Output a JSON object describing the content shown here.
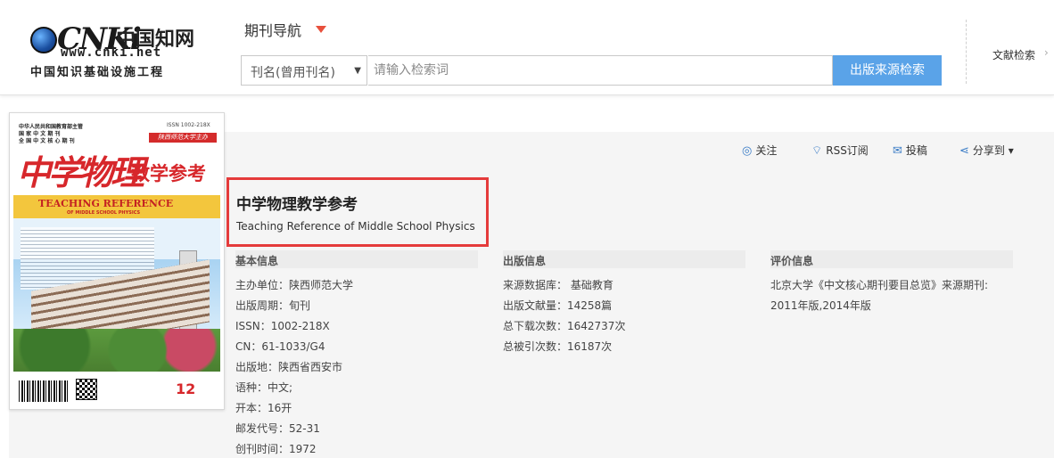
{
  "header": {
    "logo_cnki": "CNKi",
    "logo_cn": "中国知网",
    "logo_url": "www.cnki.net",
    "logo_sub": "中国知识基础设施工程",
    "nav_title": "期刊导航",
    "search_select_value": "刊名(曾用刊名)",
    "search_placeholder": "请输入检索词",
    "search_button": "出版来源检索",
    "right_link": "文献检索",
    "right_arrow": "›"
  },
  "cover": {
    "top_lines": "中华人民共和国教育部主管\n国 家 中 文 期 刊\n全 国 中 文 核 心 期 刊",
    "issn": "ISSN 1002-218X",
    "red_band": "陕西师范大学主办",
    "title_part1": "中学物理",
    "title_part2": "教学参考",
    "en_line1": "TEACHING REFERENCE",
    "en_line2": "OF MIDDLE SCHOOL PHYSICS",
    "year_issue": "12"
  },
  "actions": {
    "follow": "关注",
    "rss": "RSS订阅",
    "submit": "投稿",
    "share": "分享到 ▾"
  },
  "journal": {
    "title_cn": "中学物理教学参考",
    "title_en": "Teaching Reference of Middle School Physics"
  },
  "basic_info": {
    "heading": "基本信息",
    "rows": [
      "主办单位：陕西师范大学",
      "出版周期：旬刊",
      "ISSN：1002-218X",
      "CN：61-1033/G4",
      "出版地：陕西省西安市",
      "语种：中文;",
      "开本：16开",
      "邮发代号：52-31",
      "创刊时间：1972"
    ]
  },
  "publish_info": {
    "heading": "出版信息",
    "rows": [
      "来源数据库： 基础教育",
      "出版文献量：14258篇",
      "总下载次数：1642737次",
      "总被引次数：16187次"
    ]
  },
  "eval_info": {
    "heading": "评价信息",
    "rows": [
      "北京大学《中文核心期刊要目总览》来源期刊:",
      "2011年版,2014年版"
    ]
  },
  "colors": {
    "accent_blue": "#5aa3e8",
    "highlight_red": "#e53b3b",
    "caret_red": "#e8503c"
  }
}
